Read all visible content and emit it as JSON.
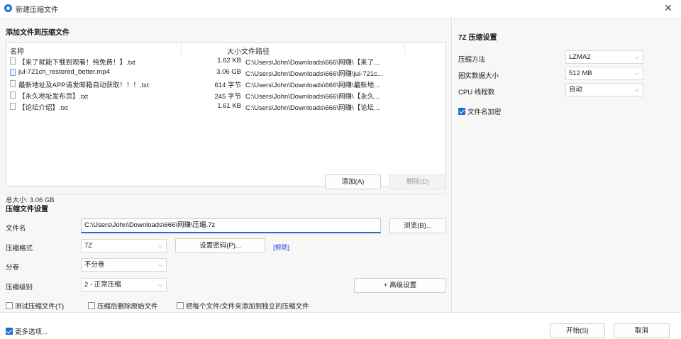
{
  "window": {
    "title": "新建压缩文件",
    "close_glyph": "✕",
    "icon": "app-icon"
  },
  "files_section": {
    "title": "添加文件到压缩文件",
    "columns": {
      "name": "名称",
      "size": "大小",
      "path": "文件路径"
    },
    "files": [
      {
        "name": "【来了就能下载到观看！纯免费！】.txt",
        "size": "1.62 KB",
        "path": "C:\\Users\\John\\Downloads\\666\\网赚\\【来了...",
        "icon": "text-file-icon"
      },
      {
        "name": "jul-721ch_restored_better.mp4",
        "size": "3.06 GB",
        "path": "C:\\Users\\John\\Downloads\\666\\网赚\\jul-721c...",
        "icon": "video-file-icon"
      },
      {
        "name": "最新地址及APP请发邮箱自动获取！！！.txt",
        "size": "614 字节",
        "path": "C:\\Users\\John\\Downloads\\666\\网赚\\最新地...",
        "icon": "text-file-icon"
      },
      {
        "name": "【永久地址发布页】.txt",
        "size": "245 字节",
        "path": "C:\\Users\\John\\Downloads\\666\\网赚\\【永久...",
        "icon": "text-file-icon"
      },
      {
        "name": "【论坛介绍】.txt",
        "size": "1.61 KB",
        "path": "C:\\Users\\John\\Downloads\\666\\网赚\\【论坛...",
        "icon": "text-file-icon"
      }
    ],
    "total_size": "总大小: 3.06 GB",
    "add_button": "添加(A)",
    "delete_button": "删除(D)"
  },
  "archive_settings": {
    "title": "压缩文件设置",
    "filename_label": "文件名",
    "filename_value": "C:\\Users\\John\\Downloads\\666\\网赚\\压缩.7z",
    "browse_button": "浏览(B)...",
    "format_label": "压缩格式",
    "format_value": "7Z",
    "password_button": "设置密码(P)...",
    "help_link": "[帮助]",
    "split_label": "分卷",
    "split_value": "不分卷",
    "level_label": "压缩级别",
    "level_value": "2 - 正常压缩",
    "advanced_button": "+ 高级设置",
    "test_checkbox": {
      "label": "测试压缩文件(T)",
      "checked": false
    },
    "delete_after_checkbox": {
      "label": "压缩后删除原始文件",
      "checked": false
    },
    "separate_checkbox": {
      "label": "把每个文件/文件夹添加到独立的压缩文件",
      "checked": false
    }
  },
  "sevenz_settings": {
    "title": "7Z 压缩设置",
    "method_label": "压缩方法",
    "method_value": "LZMA2",
    "dict_label": "固实数据大小",
    "dict_value": "512 MB",
    "threads_label": "CPU 线程数",
    "threads_value": "自动",
    "encrypt_names": {
      "label": "文件名加密",
      "checked": true
    }
  },
  "footer": {
    "more_options": {
      "label": "更多选项...",
      "checked": true
    },
    "start_button": "开始(S)",
    "cancel_button": "取消"
  },
  "colors": {
    "accent": "#1f6fd1",
    "link": "#2d3fd6"
  }
}
